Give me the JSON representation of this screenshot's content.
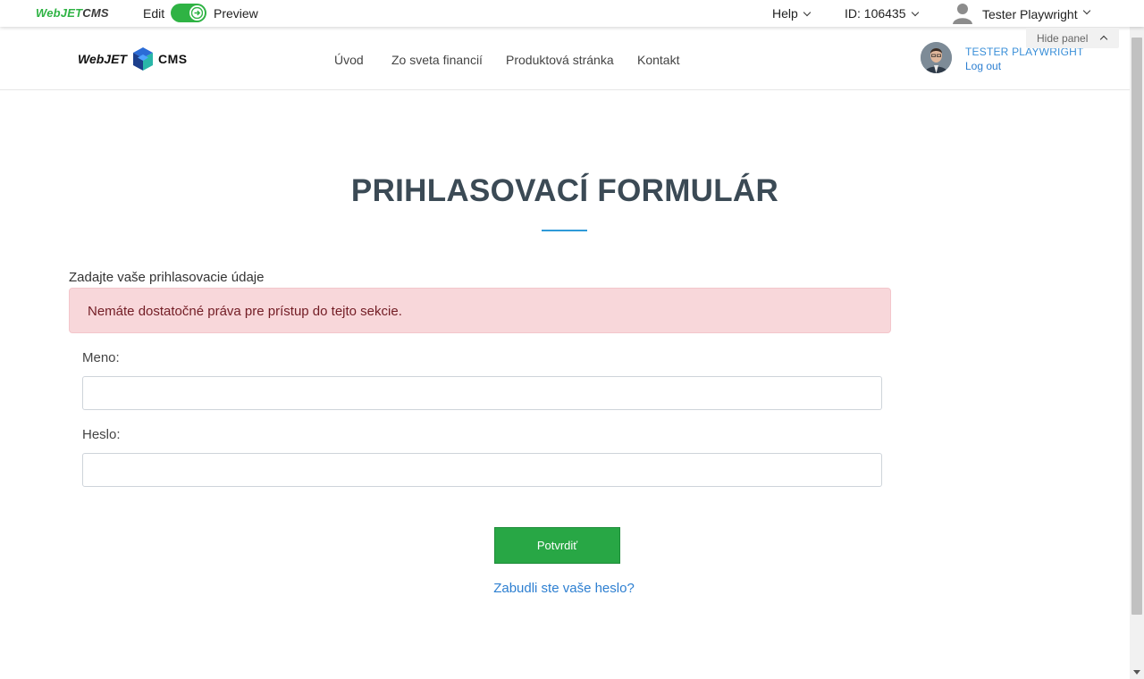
{
  "admin_bar": {
    "logo_green": "WebJET",
    "logo_dark": "CMS",
    "edit_label": "Edit",
    "preview_label": "Preview",
    "help_label": "Help",
    "id_label": "ID: 106435",
    "user_name": "Tester Playwright",
    "hide_panel": "Hide panel",
    "accent_color": "#2fb344"
  },
  "site_header": {
    "logo_left": "WebJET",
    "logo_right": "CMS",
    "nav": [
      "Úvod",
      "Zo sveta financií",
      "Produktová stránka",
      "Kontakt"
    ],
    "profile_name": "TESTER PLAYWRIGHT",
    "logout_label": "Log out"
  },
  "main": {
    "title": "PRIHLASOVACÍ FORMULÁR",
    "intro": "Zadajte vaše prihlasovacie údaje",
    "alert": "Nemáte dostatočné práva pre prístup do tejto sekcie.",
    "username_label": "Meno:",
    "username_value": "",
    "password_label": "Heslo:",
    "password_value": "",
    "submit_label": "Potvrdiť",
    "forgot_label": "Zabudli ste vaše heslo?",
    "button_color": "#28a745",
    "alert_color": "#f8d7da"
  }
}
